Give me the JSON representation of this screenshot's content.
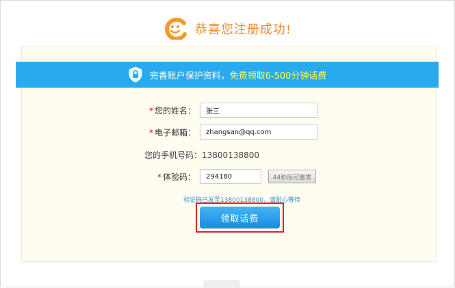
{
  "header": {
    "title": "恭喜您注册成功!"
  },
  "banner": {
    "text": "完善账户保护资料，",
    "highlight": "免费领取6-500分钟话费"
  },
  "form": {
    "name_label": "您的姓名：",
    "name_value": "张三",
    "email_label": "电子邮箱：",
    "email_value": "zhangsan@qq.com",
    "phone_label": "您的手机号码：",
    "phone_value": "13800138800",
    "code_label": "体验码：",
    "code_value": "294180",
    "resend_label": "44秒后可重发",
    "notice": "验证码已发至13800138800，请耐心等待",
    "submit_label": "领取话费"
  },
  "colors": {
    "accent": "#f08a2b",
    "banner": "#29aaf0",
    "button": "#1a8be0",
    "required": "#e60012"
  }
}
